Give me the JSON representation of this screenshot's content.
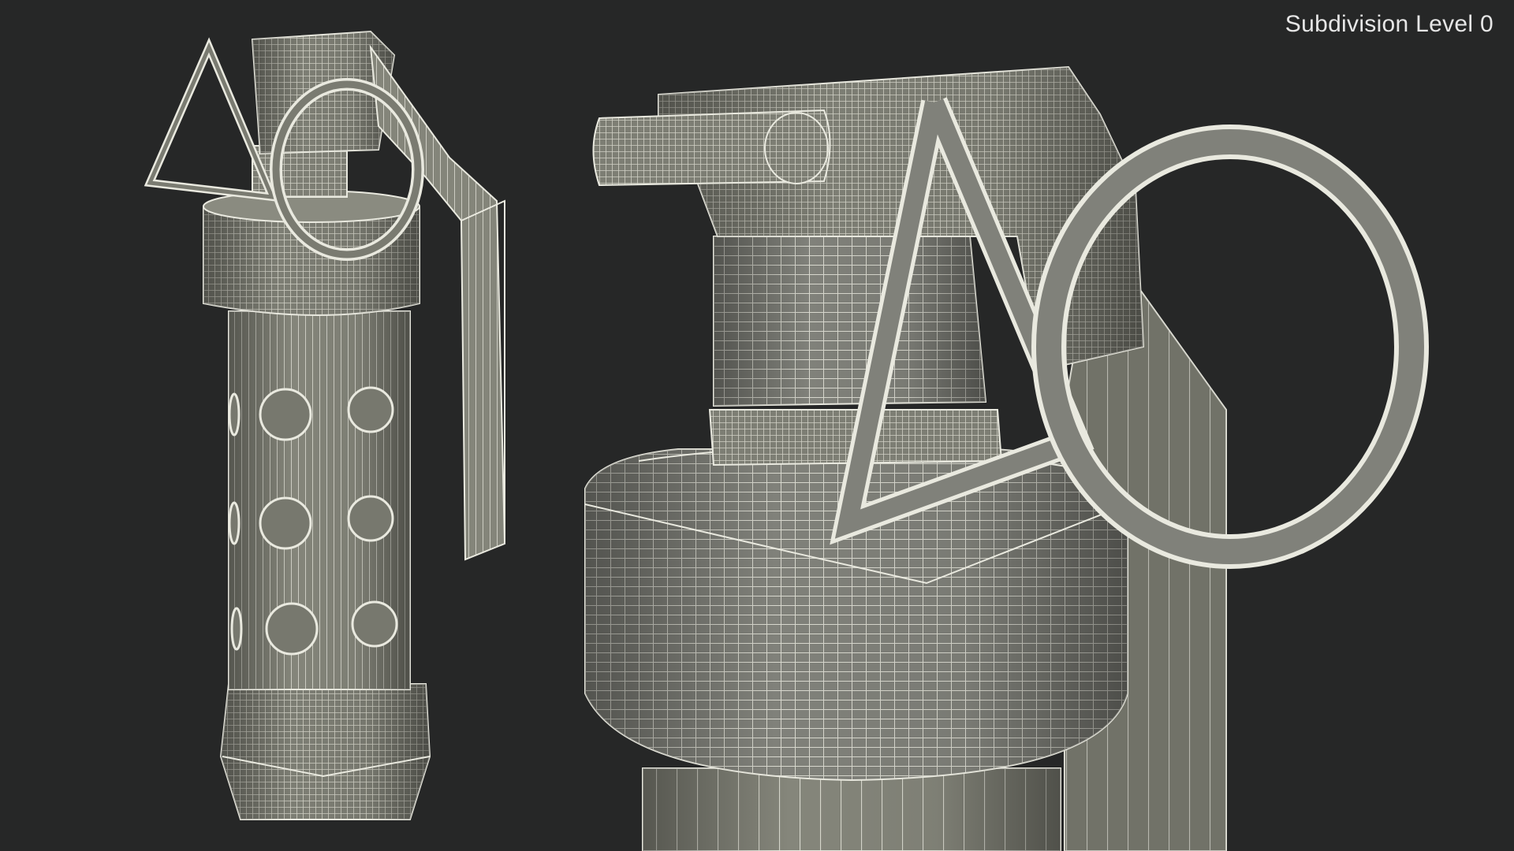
{
  "overlay": {
    "subdivision_label": "Subdivision Level 0"
  },
  "scene": {
    "subject": "flashbang grenade wireframe",
    "views": [
      "full-view",
      "closeup-view"
    ],
    "colors": {
      "background": "#262727",
      "mesh_fill": "#84857a",
      "mesh_shade": "#6c6d63",
      "mesh_dark": "#55564e",
      "wire": "#e9e9df",
      "hole": "#77786e"
    }
  }
}
